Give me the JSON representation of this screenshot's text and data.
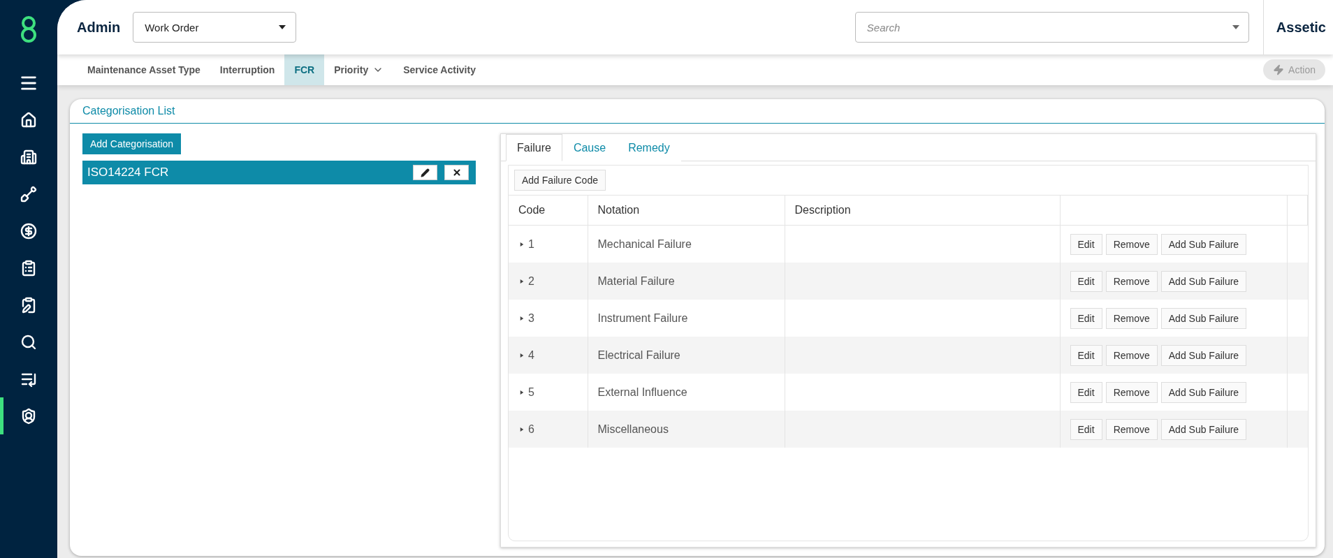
{
  "sidebar": {
    "items": [
      {
        "selected": false
      },
      {
        "selected": false
      },
      {
        "selected": false
      },
      {
        "selected": false
      },
      {
        "selected": false
      },
      {
        "selected": false
      },
      {
        "selected": false
      },
      {
        "selected": false
      },
      {
        "selected": false
      },
      {
        "selected": true
      }
    ]
  },
  "header": {
    "section": "Admin",
    "module_select": {
      "value": "Work Order"
    },
    "search": {
      "placeholder": "Search"
    },
    "brand": "Assetic"
  },
  "subnav": {
    "tabs": [
      {
        "label": "Maintenance Asset Type",
        "selected": false,
        "has_dropdown": false
      },
      {
        "label": "Interruption",
        "selected": false,
        "has_dropdown": false
      },
      {
        "label": "FCR",
        "selected": true,
        "has_dropdown": false
      },
      {
        "label": "Priority",
        "selected": false,
        "has_dropdown": true
      },
      {
        "label": "Service Activity",
        "selected": false,
        "has_dropdown": false
      }
    ],
    "action_button": {
      "label": "Action",
      "disabled": true
    }
  },
  "card": {
    "title": "Categorisation List",
    "add_button": "Add Categorisation",
    "categorisations": [
      {
        "name": "ISO14224 FCR",
        "selected": true
      }
    ],
    "detail": {
      "tabs": [
        {
          "label": "Failure",
          "selected": true
        },
        {
          "label": "Cause",
          "selected": false
        },
        {
          "label": "Remedy",
          "selected": false
        }
      ],
      "add_button": "Add Failure Code",
      "columns": [
        "Code",
        "Notation",
        "Description"
      ],
      "rows": [
        {
          "code": "1",
          "notation": "Mechanical Failure",
          "expanded": false,
          "actions": [
            "Edit",
            "Remove",
            "Add Sub Failure"
          ]
        },
        {
          "code": "2",
          "notation": "Material Failure",
          "expanded": false,
          "actions": [
            "Edit",
            "Remove",
            "Add Sub Failure"
          ]
        },
        {
          "code": "3",
          "notation": "Instrument Failure",
          "expanded": false,
          "actions": [
            "Edit",
            "Remove",
            "Add Sub Failure"
          ]
        },
        {
          "code": "4",
          "notation": "Electrical Failure",
          "expanded": false,
          "actions": [
            "Edit",
            "Remove",
            "Add Sub Failure"
          ]
        },
        {
          "code": "5",
          "notation": "External Influence",
          "expanded": false,
          "actions": [
            "Edit",
            "Remove",
            "Add Sub Failure"
          ]
        },
        {
          "code": "6",
          "notation": "Miscellaneous",
          "expanded": false,
          "actions": [
            "Edit",
            "Remove",
            "Add Sub Failure"
          ]
        }
      ]
    }
  }
}
